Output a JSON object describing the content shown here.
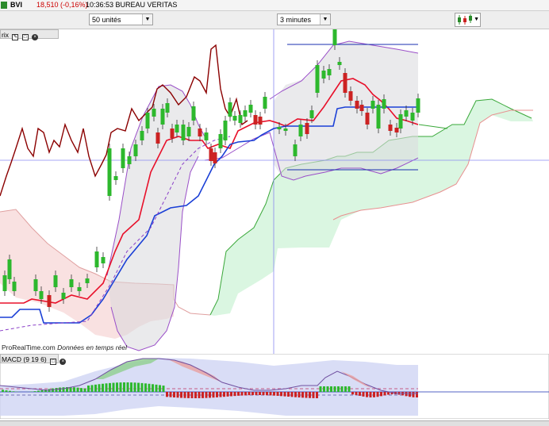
{
  "header": {
    "symbol": "BVI",
    "quote": "18,510 (-0,16%)",
    "time_and_name": "10:36:53 BUREAU VERITAS",
    "quote_color": "#cc0000"
  },
  "toolbar": {
    "units_select": "50 unités",
    "timeframe_select": "3 minutes",
    "chart_type_icon": "candlestick-chart-icon"
  },
  "price_panel": {
    "title_fragment": "rix",
    "attribution_brand": "ProRealTime.com",
    "attribution_text": "Données en temps réel"
  },
  "macd_panel": {
    "title_fragment": "MACD (9 19 6)"
  },
  "colors": {
    "bull_candle": "#2db82d",
    "bear_candle": "#cc2222",
    "tenkan": "#e8102a",
    "kijun": "#1a3fd6",
    "chikou": "#8b0000",
    "bollinger": "#9a4fc8",
    "cloud_up": "#c8f0d0",
    "cloud_down": "#f6d0d0",
    "macd_band": "#d0d4f4"
  }
}
